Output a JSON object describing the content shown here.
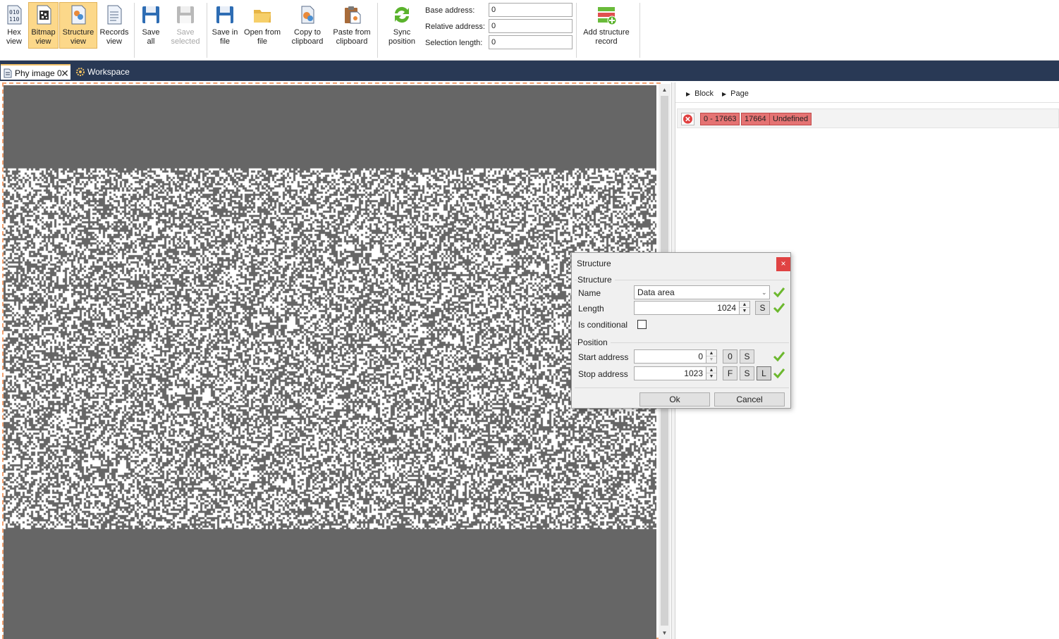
{
  "toolbar": {
    "hex_view": "Hex view",
    "bitmap_view": "Bitmap view",
    "structure_view": "Structure view",
    "records_view": "Records view",
    "save_all": "Save all",
    "save_selected": "Save selected",
    "save_in_file": "Save in file",
    "open_from_file": "Open from file",
    "copy_to_clipboard": "Copy to clipboard",
    "paste_from_clipboard": "Paste from clipboard",
    "sync_position": "Sync position",
    "add_structure_record": "Add structure record",
    "base_address_label": "Base address:",
    "base_address_value": "0",
    "relative_address_label": "Relative address:",
    "relative_address_value": "0",
    "selection_length_label": "Selection length:",
    "selection_length_value": "0"
  },
  "tabs": {
    "phy_image": "Phy image 0",
    "workspace": "Workspace"
  },
  "breadcrumb": {
    "block": "Block",
    "page": "Page"
  },
  "record": {
    "range": "0 -  17663",
    "size": "17664",
    "type": "Undefined"
  },
  "dialog": {
    "title": "Structure",
    "close": "×",
    "group_structure": "Structure",
    "name_label": "Name",
    "name_value": "Data area",
    "length_label": "Length",
    "length_value": "1024",
    "is_conditional_label": "Is conditional",
    "is_conditional": false,
    "group_position": "Position",
    "start_label": "Start address",
    "start_value": "0",
    "stop_label": "Stop address",
    "stop_value": "1023",
    "btn_zero": "0",
    "btn_s": "S",
    "btn_f": "F",
    "btn_l": "L",
    "ok": "Ok",
    "cancel": "Cancel"
  },
  "colors": {
    "ribbon_active": "#fcd88a",
    "tabstrip": "#293955",
    "record_chip": "#e57373",
    "check_green": "#6cb82e",
    "bitmap_gray": "#666666"
  },
  "icons": {
    "hex_view": "hex-view-icon",
    "bitmap_view": "bitmap-view-icon",
    "structure_view": "structure-view-icon",
    "records_view": "records-view-icon",
    "save": "floppy-disk-icon",
    "open": "folder-icon",
    "copy": "copy-clipboard-icon",
    "paste": "paste-clipboard-icon",
    "sync": "sync-arrows-icon",
    "add_record": "add-structure-record-icon"
  }
}
